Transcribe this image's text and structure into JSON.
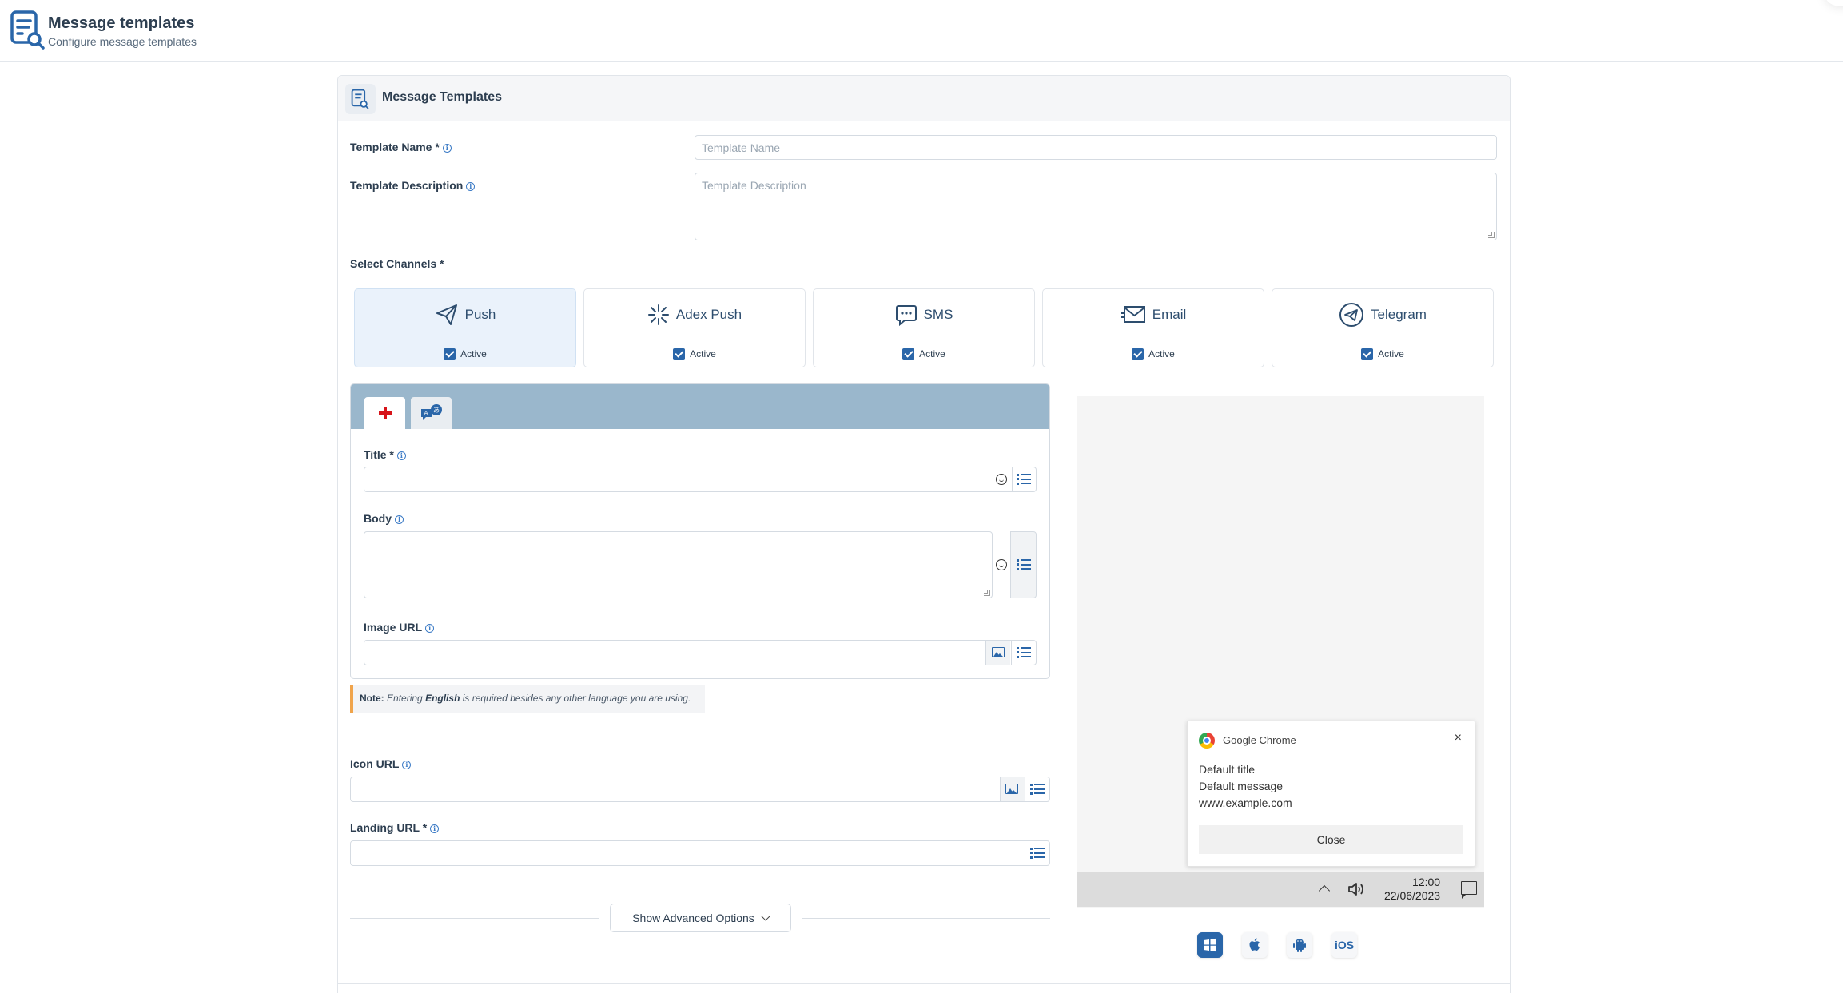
{
  "header": {
    "title": "Message templates",
    "subtitle": "Configure message templates"
  },
  "card": {
    "title": "Message Templates"
  },
  "form": {
    "template_name_label": "Template Name *",
    "template_name_placeholder": "Template Name",
    "template_description_label": "Template Description",
    "template_description_placeholder": "Template Description",
    "select_channels_label": "Select Channels *"
  },
  "channels": [
    {
      "label": "Push",
      "status": "Active",
      "icon": "send-icon",
      "selected": true
    },
    {
      "label": "Adex Push",
      "status": "Active",
      "icon": "sparkle-icon",
      "selected": false
    },
    {
      "label": "SMS",
      "status": "Active",
      "icon": "chat-bubble-icon",
      "selected": false
    },
    {
      "label": "Email",
      "status": "Active",
      "icon": "envelope-icon",
      "selected": false
    },
    {
      "label": "Telegram",
      "status": "Active",
      "icon": "telegram-icon",
      "selected": false
    }
  ],
  "language": {
    "tabs": [
      {
        "icon": "english-flag-icon",
        "active": true
      },
      {
        "icon": "translate-icon",
        "active": false
      }
    ],
    "title_label": "Title *",
    "body_label": "Body",
    "image_url_label": "Image URL"
  },
  "note": {
    "prefix": "Note:",
    "text_before": "Entering",
    "bold": "English",
    "text_after": "is required besides any other language you are using."
  },
  "icon_url_label": "Icon URL",
  "landing_url_label": "Landing URL *",
  "advanced_button": "Show Advanced Options",
  "preview": {
    "app_name": "Google Chrome",
    "title": "Default title",
    "message": "Default message",
    "url": "www.example.com",
    "close_button": "Close",
    "time": "12:00",
    "date": "22/06/2023",
    "close_icon": "×"
  },
  "platforms": [
    {
      "icon": "windows-icon",
      "active": true
    },
    {
      "icon": "apple-icon",
      "active": false
    },
    {
      "icon": "android-icon",
      "active": false
    },
    {
      "label": "iOS",
      "active": false
    }
  ],
  "colors": {
    "primary": "#2a66a9",
    "tab_bar": "#9ab7cc",
    "note_accent": "#f0a44b",
    "selected_channel_bg": "#eaf2fb"
  }
}
